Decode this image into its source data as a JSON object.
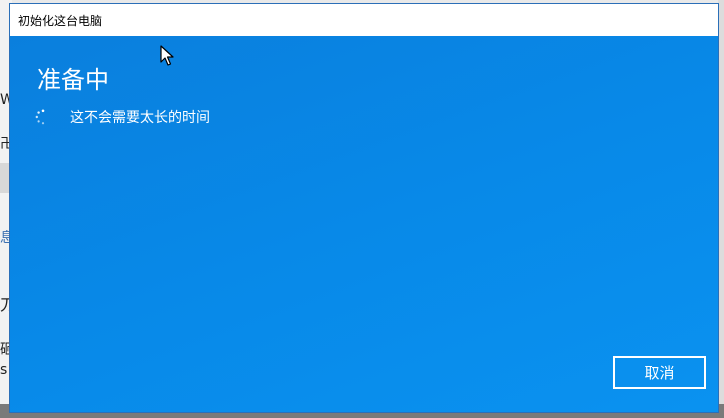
{
  "window": {
    "title": "初始化这台电脑"
  },
  "main": {
    "heading": "准备中",
    "status_text": "这不会需要太长的时间",
    "spinner_icon": "loading-spinner-icon"
  },
  "actions": {
    "cancel_label": "取消"
  },
  "background_fragments": [
    "W",
    "卍",
    "息",
    "刀",
    "砸",
    "s"
  ],
  "colors": {
    "dialog_background": "#0078d7",
    "titlebar_background": "#ffffff",
    "text": "#ffffff"
  }
}
